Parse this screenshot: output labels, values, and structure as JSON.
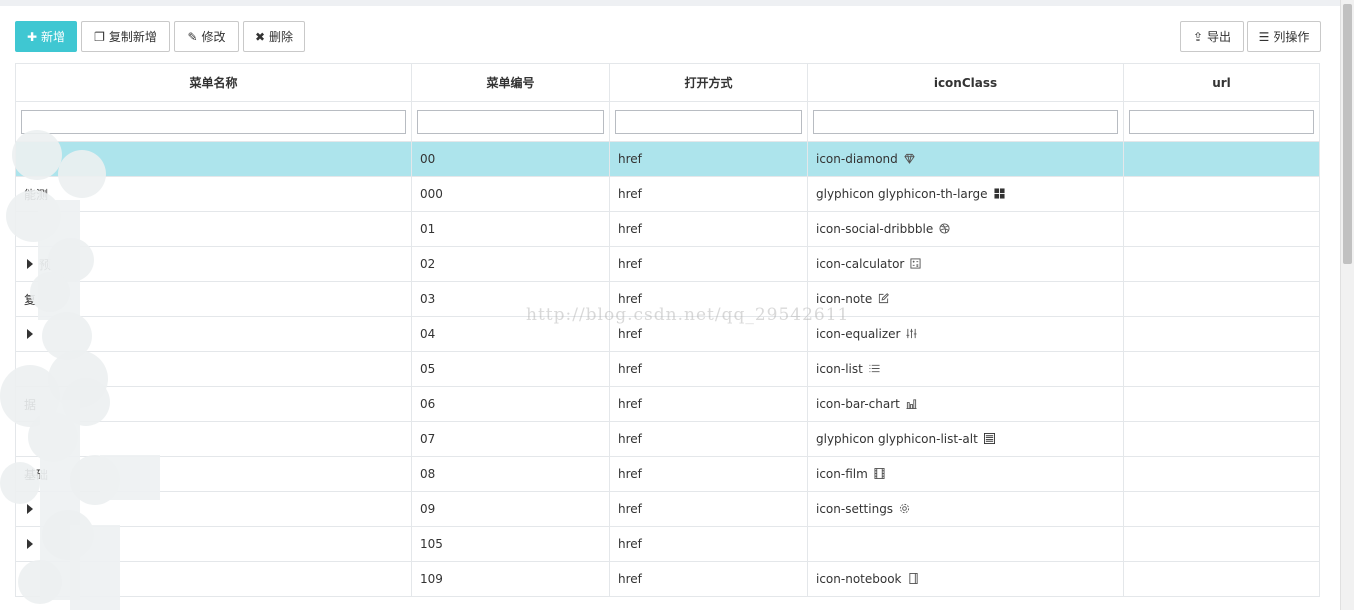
{
  "toolbar": {
    "add_label": "新增",
    "copy_add_label": "复制新增",
    "edit_label": "修改",
    "delete_label": "删除",
    "export_label": "导出",
    "columns_label": "列操作"
  },
  "table": {
    "columns": [
      "菜单名称",
      "菜单编号",
      "打开方式",
      "iconClass",
      "url"
    ],
    "rows": [
      {
        "name": "",
        "code": "00",
        "open": "href",
        "iconClass": "icon-diamond",
        "icon": "diamond-icon",
        "url": "",
        "caret": false
      },
      {
        "name": "能测",
        "code": "000",
        "open": "href",
        "iconClass": "glyphicon glyphicon-th-large",
        "icon": "th-large-icon",
        "url": "",
        "caret": false
      },
      {
        "name": "",
        "code": "01",
        "open": "href",
        "iconClass": "icon-social-dribbble",
        "icon": "dribbble-icon",
        "url": "",
        "caret": false
      },
      {
        "name": "预",
        "code": "02",
        "open": "href",
        "iconClass": "icon-calculator",
        "icon": "calculator-icon",
        "url": "",
        "caret": true
      },
      {
        "name": "复",
        "code": "03",
        "open": "href",
        "iconClass": "icon-note",
        "icon": "note-icon",
        "url": "",
        "caret": false
      },
      {
        "name": "",
        "code": "04",
        "open": "href",
        "iconClass": "icon-equalizer",
        "icon": "equalizer-icon",
        "url": "",
        "caret": true
      },
      {
        "name": "",
        "code": "05",
        "open": "href",
        "iconClass": "icon-list",
        "icon": "list-icon",
        "url": "",
        "caret": false
      },
      {
        "name": "据",
        "code": "06",
        "open": "href",
        "iconClass": "icon-bar-chart",
        "icon": "bar-chart-icon",
        "url": "",
        "caret": false
      },
      {
        "name": "",
        "code": "07",
        "open": "href",
        "iconClass": "glyphicon glyphicon-list-alt",
        "icon": "list-alt-icon",
        "url": "",
        "caret": false
      },
      {
        "name": "基础",
        "code": "08",
        "open": "href",
        "iconClass": "icon-film",
        "icon": "film-icon",
        "url": "",
        "caret": false
      },
      {
        "name": "",
        "code": "09",
        "open": "href",
        "iconClass": "icon-settings",
        "icon": "settings-icon",
        "url": "",
        "caret": true
      },
      {
        "name": "",
        "code": "105",
        "open": "href",
        "iconClass": "",
        "icon": "",
        "url": "",
        "caret": true
      },
      {
        "name": "",
        "code": "109",
        "open": "href",
        "iconClass": "icon-notebook",
        "icon": "notebook-icon",
        "url": "",
        "caret": false
      }
    ]
  },
  "watermark": "http://blog.csdn.net/qq_29542611",
  "colors": {
    "primary": "#3fc7d2",
    "selected_row": "#ade4ec",
    "border": "#e4e7ea"
  }
}
